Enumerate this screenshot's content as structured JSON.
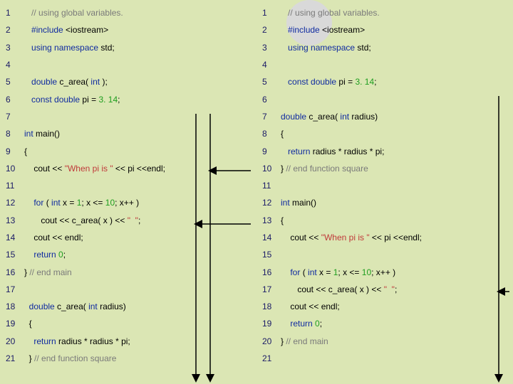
{
  "left": {
    "lines": [
      {
        "n": "1",
        "tokens": [
          {
            "t": "   ",
            "c": "op"
          },
          {
            "t": "// using global variables.",
            "c": "cm"
          }
        ]
      },
      {
        "n": "2",
        "tokens": [
          {
            "t": "   ",
            "c": "op"
          },
          {
            "t": "#include",
            "c": "kw"
          },
          {
            "t": " <iostream>",
            "c": "op"
          }
        ]
      },
      {
        "n": "3",
        "tokens": [
          {
            "t": "   ",
            "c": "op"
          },
          {
            "t": "using namespace",
            "c": "kw"
          },
          {
            "t": " std;",
            "c": "op"
          }
        ]
      },
      {
        "n": "4",
        "tokens": []
      },
      {
        "n": "5",
        "tokens": [
          {
            "t": "   ",
            "c": "op"
          },
          {
            "t": "double",
            "c": "kw"
          },
          {
            "t": " c_area( ",
            "c": "op"
          },
          {
            "t": "int",
            "c": "kw"
          },
          {
            "t": " );",
            "c": "op"
          }
        ]
      },
      {
        "n": "6",
        "tokens": [
          {
            "t": "   ",
            "c": "op"
          },
          {
            "t": "const double",
            "c": "kw"
          },
          {
            "t": " pi = ",
            "c": "op"
          },
          {
            "t": "3. 14",
            "c": "num"
          },
          {
            "t": ";",
            "c": "op"
          }
        ]
      },
      {
        "n": "7",
        "tokens": []
      },
      {
        "n": "8",
        "tokens": [
          {
            "t": "int",
            "c": "kw"
          },
          {
            "t": " main()",
            "c": "op"
          }
        ]
      },
      {
        "n": "9",
        "tokens": [
          {
            "t": "{",
            "c": "op"
          }
        ]
      },
      {
        "n": "10",
        "tokens": [
          {
            "t": "    cout << ",
            "c": "op"
          },
          {
            "t": "\"When pi is \"",
            "c": "str"
          },
          {
            "t": " << pi <<endl;",
            "c": "op"
          }
        ]
      },
      {
        "n": "11",
        "tokens": []
      },
      {
        "n": "12",
        "tokens": [
          {
            "t": "    ",
            "c": "op"
          },
          {
            "t": "for",
            "c": "kw"
          },
          {
            "t": " ( ",
            "c": "op"
          },
          {
            "t": "int",
            "c": "kw"
          },
          {
            "t": " x = ",
            "c": "op"
          },
          {
            "t": "1",
            "c": "num"
          },
          {
            "t": "; x <= ",
            "c": "op"
          },
          {
            "t": "10",
            "c": "num"
          },
          {
            "t": "; x++ )",
            "c": "op"
          }
        ]
      },
      {
        "n": "13",
        "tokens": [
          {
            "t": "       cout << c_area( x ) << ",
            "c": "op"
          },
          {
            "t": "\"  \"",
            "c": "str"
          },
          {
            "t": ";",
            "c": "op"
          }
        ]
      },
      {
        "n": "14",
        "tokens": [
          {
            "t": "    cout << endl;",
            "c": "op"
          }
        ]
      },
      {
        "n": "15",
        "tokens": [
          {
            "t": "    ",
            "c": "op"
          },
          {
            "t": "return",
            "c": "kw"
          },
          {
            "t": " ",
            "c": "op"
          },
          {
            "t": "0",
            "c": "num"
          },
          {
            "t": ";",
            "c": "op"
          }
        ]
      },
      {
        "n": "16",
        "tokens": [
          {
            "t": "} ",
            "c": "op"
          },
          {
            "t": "// end main",
            "c": "cm"
          }
        ]
      },
      {
        "n": "17",
        "tokens": []
      },
      {
        "n": "18",
        "tokens": [
          {
            "t": "  ",
            "c": "op"
          },
          {
            "t": "double",
            "c": "kw"
          },
          {
            "t": " c_area( ",
            "c": "op"
          },
          {
            "t": "int",
            "c": "kw"
          },
          {
            "t": " radius)",
            "c": "op"
          }
        ]
      },
      {
        "n": "19",
        "tokens": [
          {
            "t": "  {",
            "c": "op"
          }
        ]
      },
      {
        "n": "20",
        "tokens": [
          {
            "t": "    ",
            "c": "op"
          },
          {
            "t": "return",
            "c": "kw"
          },
          {
            "t": " radius * radius * pi;",
            "c": "op"
          }
        ]
      },
      {
        "n": "21",
        "tokens": [
          {
            "t": "  } ",
            "c": "op"
          },
          {
            "t": "// end function square",
            "c": "cm"
          }
        ]
      }
    ]
  },
  "right": {
    "lines": [
      {
        "n": "1",
        "tokens": [
          {
            "t": "   ",
            "c": "op"
          },
          {
            "t": "// using global variables.",
            "c": "cm"
          }
        ]
      },
      {
        "n": "2",
        "tokens": [
          {
            "t": "   ",
            "c": "op"
          },
          {
            "t": "#include",
            "c": "kw"
          },
          {
            "t": " <iostream>",
            "c": "op"
          }
        ]
      },
      {
        "n": "3",
        "tokens": [
          {
            "t": "   ",
            "c": "op"
          },
          {
            "t": "using namespace",
            "c": "kw"
          },
          {
            "t": " std;",
            "c": "op"
          }
        ]
      },
      {
        "n": "4",
        "tokens": []
      },
      {
        "n": "5",
        "tokens": [
          {
            "t": "   ",
            "c": "op"
          },
          {
            "t": "const double",
            "c": "kw"
          },
          {
            "t": " pi = ",
            "c": "op"
          },
          {
            "t": "3. 14",
            "c": "num"
          },
          {
            "t": ";",
            "c": "op"
          }
        ]
      },
      {
        "n": "6",
        "tokens": []
      },
      {
        "n": "7",
        "tokens": [
          {
            "t": "double",
            "c": "kw"
          },
          {
            "t": " c_area( ",
            "c": "op"
          },
          {
            "t": "int",
            "c": "kw"
          },
          {
            "t": " radius)",
            "c": "op"
          }
        ]
      },
      {
        "n": "8",
        "tokens": [
          {
            "t": "{",
            "c": "op"
          }
        ]
      },
      {
        "n": "9",
        "tokens": [
          {
            "t": "   ",
            "c": "op"
          },
          {
            "t": "return",
            "c": "kw"
          },
          {
            "t": " radius * radius * pi;",
            "c": "op"
          }
        ]
      },
      {
        "n": "10",
        "tokens": [
          {
            "t": "} ",
            "c": "op"
          },
          {
            "t": "// end function square",
            "c": "cm"
          }
        ]
      },
      {
        "n": "11",
        "tokens": []
      },
      {
        "n": "12",
        "tokens": [
          {
            "t": "int",
            "c": "kw"
          },
          {
            "t": " main()",
            "c": "op"
          }
        ]
      },
      {
        "n": "13",
        "tokens": [
          {
            "t": "{",
            "c": "op"
          }
        ]
      },
      {
        "n": "14",
        "tokens": [
          {
            "t": "    cout << ",
            "c": "op"
          },
          {
            "t": "\"When pi is \"",
            "c": "str"
          },
          {
            "t": " << pi <<endl;",
            "c": "op"
          }
        ]
      },
      {
        "n": "15",
        "tokens": []
      },
      {
        "n": "16",
        "tokens": [
          {
            "t": "    ",
            "c": "op"
          },
          {
            "t": "for",
            "c": "kw"
          },
          {
            "t": " ( ",
            "c": "op"
          },
          {
            "t": "int",
            "c": "kw"
          },
          {
            "t": " x = ",
            "c": "op"
          },
          {
            "t": "1",
            "c": "num"
          },
          {
            "t": "; x <= ",
            "c": "op"
          },
          {
            "t": "10",
            "c": "num"
          },
          {
            "t": "; x++ )",
            "c": "op"
          }
        ]
      },
      {
        "n": "17",
        "tokens": [
          {
            "t": "       cout << c_area( x ) << ",
            "c": "op"
          },
          {
            "t": "\"  \"",
            "c": "str"
          },
          {
            "t": ";",
            "c": "op"
          }
        ]
      },
      {
        "n": "18",
        "tokens": [
          {
            "t": "    cout << endl;",
            "c": "op"
          }
        ]
      },
      {
        "n": "19",
        "tokens": [
          {
            "t": "    ",
            "c": "op"
          },
          {
            "t": "return",
            "c": "kw"
          },
          {
            "t": " ",
            "c": "op"
          },
          {
            "t": "0",
            "c": "num"
          },
          {
            "t": ";",
            "c": "op"
          }
        ]
      },
      {
        "n": "20",
        "tokens": [
          {
            "t": "} ",
            "c": "op"
          },
          {
            "t": "// end main",
            "c": "cm"
          }
        ]
      },
      {
        "n": "21",
        "tokens": []
      }
    ]
  }
}
